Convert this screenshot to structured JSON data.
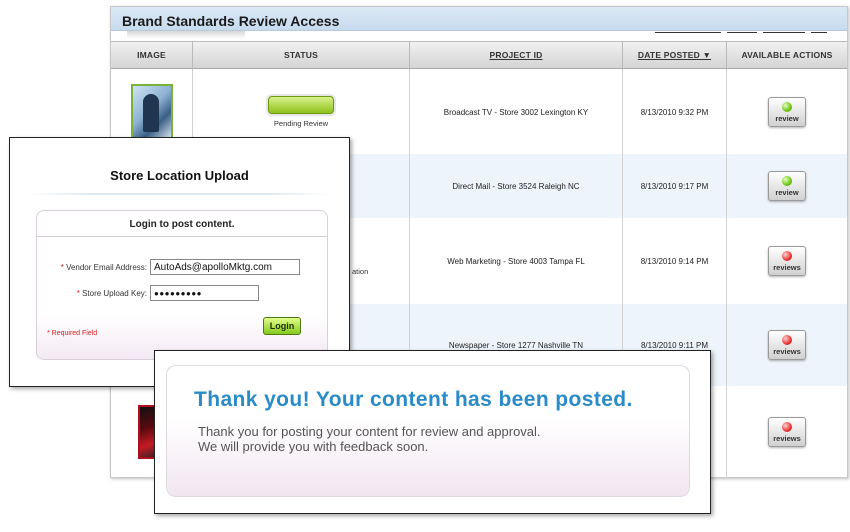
{
  "review": {
    "title": "Brand Standards Review Access",
    "columns": [
      "IMAGE",
      "STATUS",
      "PROJECT ID",
      "DATE POSTED ▼",
      "AVAILABLE ACTIONS"
    ],
    "rows": [
      {
        "status": "Pending Review",
        "project": "Broadcast TV - Store 3002 Lexington KY",
        "date": "8/13/2010 9:32 PM",
        "action": "review",
        "indicator": "green"
      },
      {
        "project": "Direct Mail - Store 3524 Raleigh NC",
        "date": "8/13/2010 9:17 PM",
        "action": "review",
        "indicator": "green"
      },
      {
        "status_fragment": "ation",
        "project": "Web Marketing - Store 4003 Tampa FL",
        "date": "8/13/2010 9:14 PM",
        "action": "reviews",
        "indicator": "red"
      },
      {
        "project": "Newspaper - Store 1277 Nashville TN",
        "date": "8/13/2010 9:11 PM",
        "action": "reviews",
        "indicator": "red"
      },
      {
        "action": "reviews",
        "indicator": "red"
      }
    ]
  },
  "login": {
    "title": "Store Location Upload",
    "heading": "Login to post content.",
    "required_mark": "*",
    "email_label": "Vendor Email Address:",
    "email_value": "AutoAds@apolloMktg.com",
    "key_label": "Store Upload Key:",
    "key_value": "●●●●●●●●●",
    "required_note": "* Required Field",
    "button": "Login"
  },
  "thanks": {
    "headline": "Thank you! Your content has been posted.",
    "line1": "Thank you for posting your content for review and approval.",
    "line2": "We will provide you with feedback soon."
  },
  "colors": {
    "accent_blue": "#2a8bc9",
    "status_green": "#8ec21a",
    "alert_red": "#e83434",
    "title_bar": "#c7dbef"
  }
}
